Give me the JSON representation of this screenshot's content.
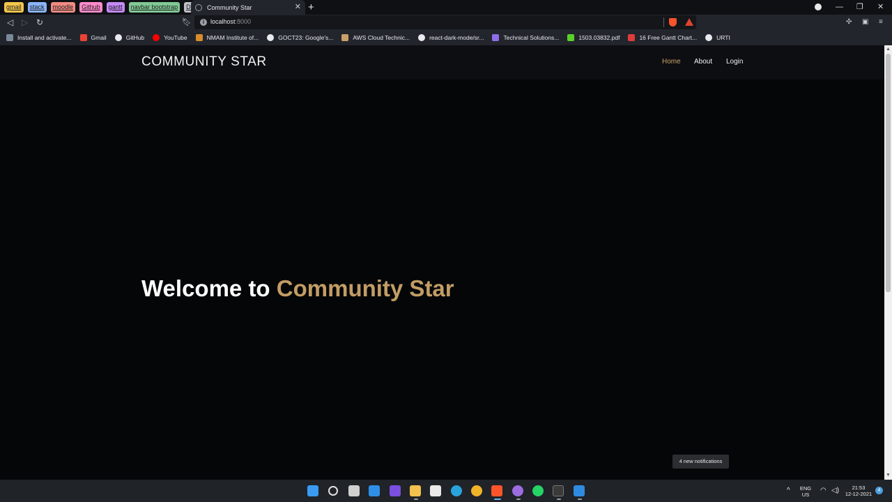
{
  "browser": {
    "tab_groups": [
      {
        "label": "gmail",
        "color": "#f3c64c"
      },
      {
        "label": "stack",
        "color": "#8ab4f8"
      },
      {
        "label": "moodle",
        "color": "#f28b82"
      },
      {
        "label": "Github",
        "color": "#ff8bcb"
      },
      {
        "label": "gantt",
        "color": "#c58af9"
      },
      {
        "label": "navbar bootstrap",
        "color": "#81c995"
      },
      {
        "label": "DEV",
        "color": "#bdc1c6"
      }
    ],
    "active_tab": {
      "title": "Community Star",
      "close": "✕"
    },
    "new_tab": "+",
    "window_controls": {
      "minimize": "—",
      "restore": "❐",
      "close": "✕"
    },
    "url": {
      "host": "localhost",
      "port": ":8000"
    },
    "bookmarks": [
      {
        "label": "Install and activate...",
        "icon_color": "#7a8a9a"
      },
      {
        "label": "Gmail",
        "icon_color": "#ea4335"
      },
      {
        "label": "GitHub",
        "icon_color": "#e8eaed"
      },
      {
        "label": "YouTube",
        "icon_color": "#ff0000"
      },
      {
        "label": "NMAM Institute of...",
        "icon_color": "#d98c2b"
      },
      {
        "label": "GOCT23: Google's...",
        "icon_color": "#e8eaed"
      },
      {
        "label": "AWS Cloud Technic...",
        "icon_color": "#caa06a"
      },
      {
        "label": "react-dark-mode/sr...",
        "icon_color": "#e8eaed"
      },
      {
        "label": "Technical Solutions...",
        "icon_color": "#8e6ee8"
      },
      {
        "label": "1503.03832.pdf",
        "icon_color": "#5ad02a"
      },
      {
        "label": "16 Free Gantt Chart...",
        "icon_color": "#e03b3b"
      },
      {
        "label": "URTI",
        "icon_color": "#e8eaed"
      }
    ]
  },
  "site": {
    "brand": "COMMUNITY STAR",
    "nav": {
      "home": "Home",
      "about": "About",
      "login": "Login"
    },
    "hero": {
      "prefix": "Welcome to ",
      "highlight": "Community Star"
    },
    "accent_color": "#c29d65"
  },
  "notification_toast": "4 new notifications",
  "taskbar": {
    "language": "ENG",
    "region": "US",
    "time": "21:53",
    "date": "12-12-2021",
    "notification_count": "4",
    "tray_chevron": "^",
    "apps": [
      {
        "name": "start",
        "color": "#3a9bf0"
      },
      {
        "name": "search",
        "color": "#e0e0e0"
      },
      {
        "name": "task-view",
        "color": "#d0d0d0"
      },
      {
        "name": "widgets",
        "color": "#2f8fe6"
      },
      {
        "name": "amazon-music",
        "color": "#7b4fe0"
      },
      {
        "name": "file-explorer",
        "color": "#f2c14e"
      },
      {
        "name": "store",
        "color": "#e9e9e9"
      },
      {
        "name": "edge",
        "color": "#2aa3dc"
      },
      {
        "name": "chrome",
        "color": "#f0b429"
      },
      {
        "name": "brave",
        "color": "#fb542b"
      },
      {
        "name": "github-desktop",
        "color": "#9b6de0"
      },
      {
        "name": "whatsapp",
        "color": "#25d366"
      },
      {
        "name": "terminal",
        "color": "#3a3a3a"
      },
      {
        "name": "vscode",
        "color": "#2f8be0"
      }
    ]
  }
}
